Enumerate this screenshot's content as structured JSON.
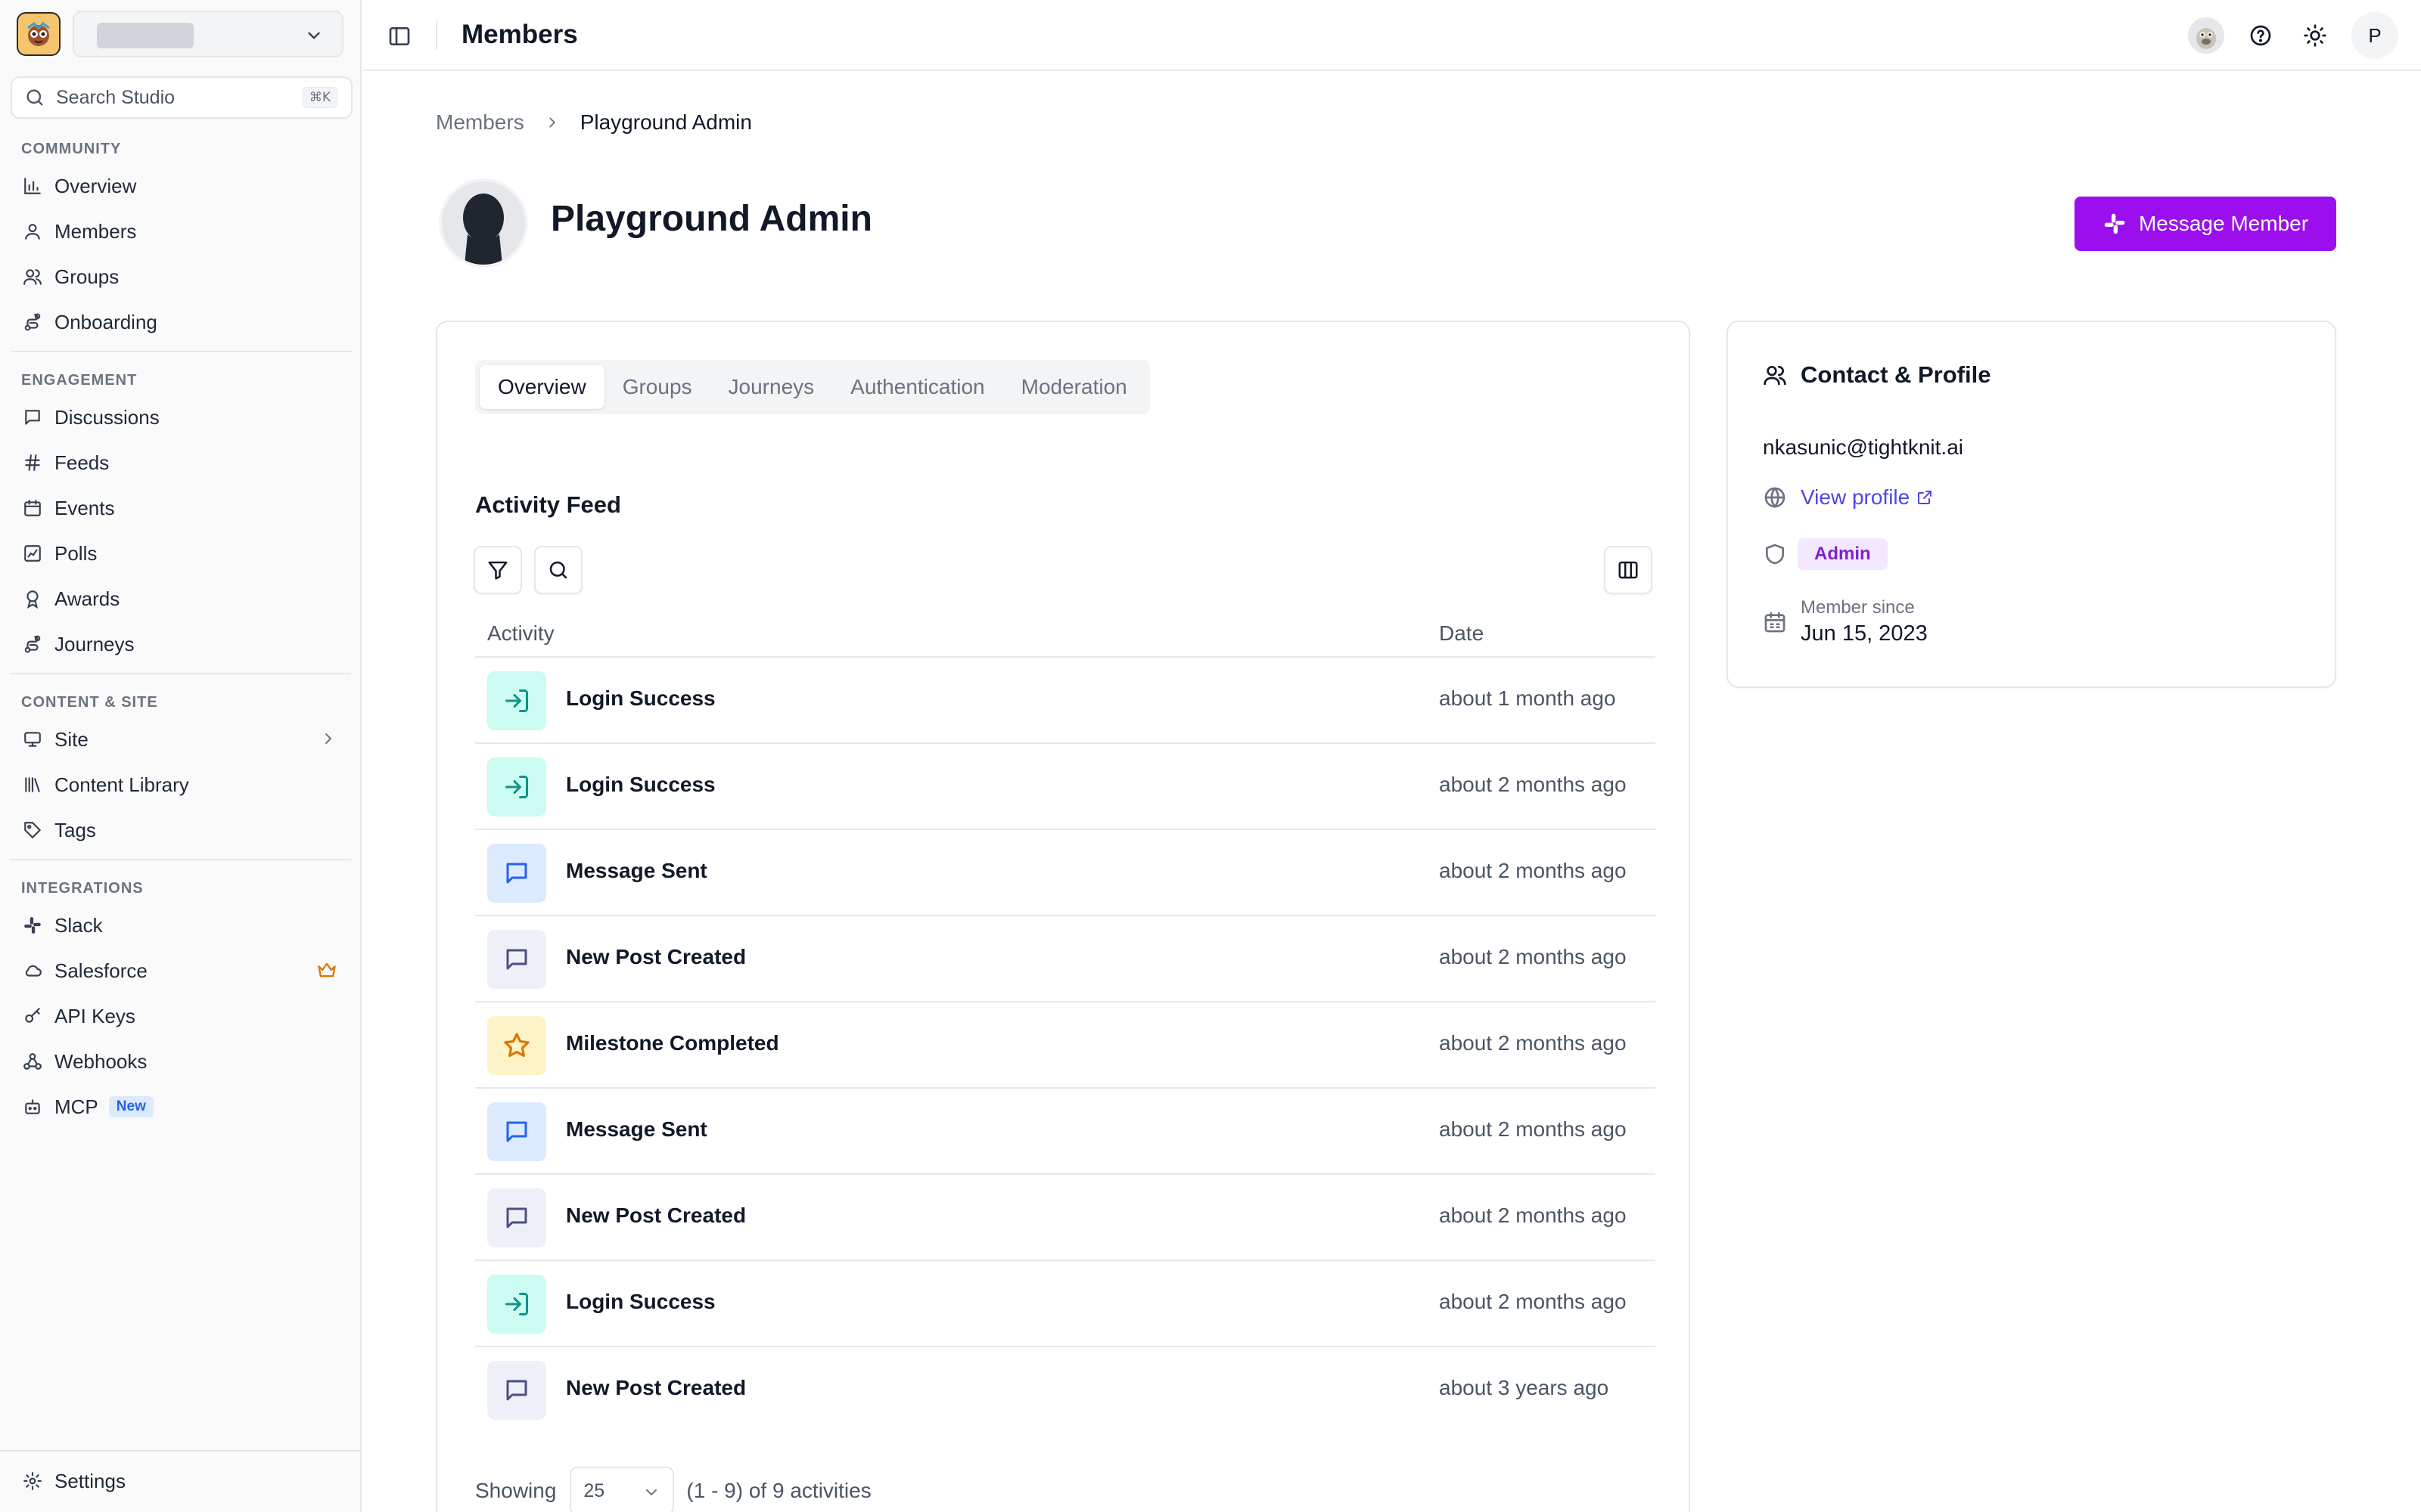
{
  "sidebar": {
    "search_placeholder": "Search Studio",
    "search_shortcut": "⌘K",
    "sections": {
      "community": "COMMUNITY",
      "engagement": "ENGAGEMENT",
      "content": "CONTENT & SITE",
      "integrations": "INTEGRATIONS"
    },
    "items": {
      "overview": "Overview",
      "members": "Members",
      "groups": "Groups",
      "onboarding": "Onboarding",
      "discussions": "Discussions",
      "feeds": "Feeds",
      "events": "Events",
      "polls": "Polls",
      "awards": "Awards",
      "journeys": "Journeys",
      "site": "Site",
      "content_library": "Content Library",
      "tags": "Tags",
      "slack": "Slack",
      "salesforce": "Salesforce",
      "api_keys": "API Keys",
      "webhooks": "Webhooks",
      "mcp": "MCP",
      "mcp_badge": "New",
      "settings": "Settings"
    }
  },
  "topbar": {
    "title": "Members",
    "user_initial": "P"
  },
  "breadcrumb": {
    "parent": "Members",
    "current": "Playground Admin"
  },
  "profile": {
    "name": "Playground Admin",
    "message_button": "Message Member"
  },
  "tabs": [
    "Overview",
    "Groups",
    "Journeys",
    "Authentication",
    "Moderation"
  ],
  "activity": {
    "title": "Activity Feed",
    "col_activity": "Activity",
    "col_date": "Date",
    "rows": [
      {
        "label": "Login Success",
        "date": "about 1 month ago"
      },
      {
        "label": "Login Success",
        "date": "about 2 months ago"
      },
      {
        "label": "Message Sent",
        "date": "about 2 months ago"
      },
      {
        "label": "New Post Created",
        "date": "about 2 months ago"
      },
      {
        "label": "Milestone Completed",
        "date": "about 2 months ago"
      },
      {
        "label": "Message Sent",
        "date": "about 2 months ago"
      },
      {
        "label": "New Post Created",
        "date": "about 2 months ago"
      },
      {
        "label": "Login Success",
        "date": "about 2 months ago"
      },
      {
        "label": "New Post Created",
        "date": "about 3 years ago"
      }
    ],
    "pager_showing": "Showing",
    "pager_size": "25",
    "pager_count": "(1 - 9) of 9 activities"
  },
  "contact": {
    "title": "Contact & Profile",
    "email": "nkasunic@tightknit.ai",
    "view_profile": "View profile",
    "role": "Admin",
    "member_since_label": "Member since",
    "member_since_value": "Jun 15, 2023"
  },
  "colors": {
    "accent": "#9b0fef",
    "login_bg": "#ccfbf1",
    "login_fg": "#0d9488",
    "message_bg": "#dbeafe",
    "message_fg": "#2563eb",
    "post_bg": "#eef0f8",
    "post_fg": "#4b5080",
    "milestone_bg": "#fef3c7",
    "milestone_fg": "#d97706"
  }
}
